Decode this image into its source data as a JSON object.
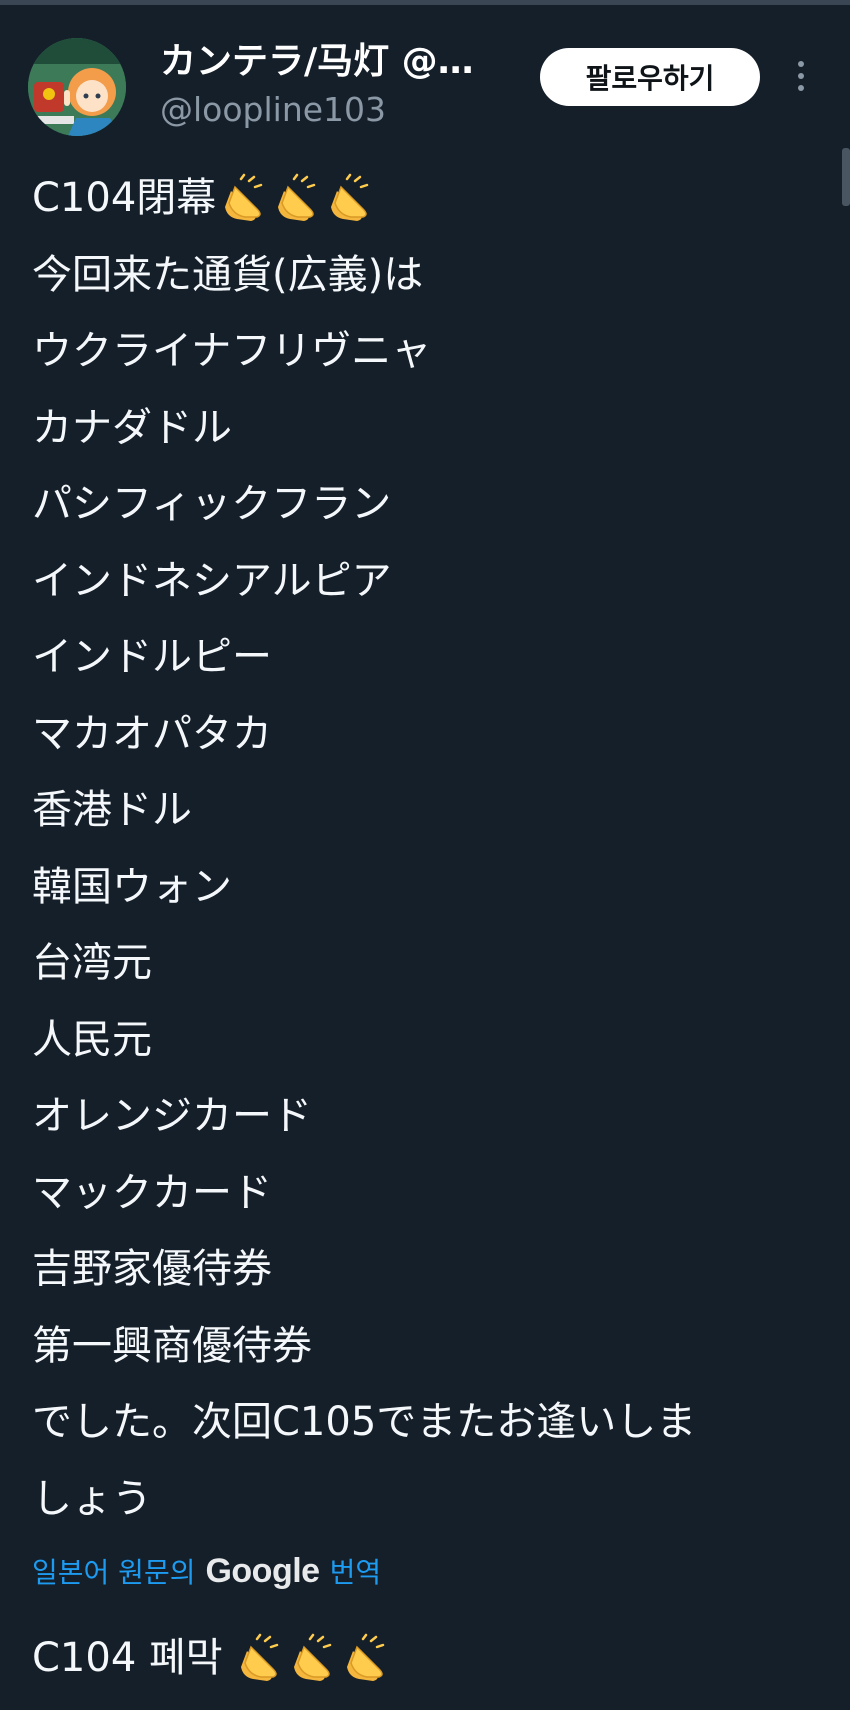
{
  "author": {
    "display_name": "カンテラ/马灯 @…",
    "handle": "@loopline103"
  },
  "actions": {
    "follow_label": "팔로우하기",
    "more_icon": "more-vertical-icon"
  },
  "tweet": {
    "lines": [
      "C104閉幕",
      "今回来た通貨(広義)は",
      "ウクライナフリヴニャ",
      "カナダドル",
      "パシフィックフラン",
      "インドネシアルピア",
      "インドルピー",
      "マカオパタカ",
      "香港ドル",
      "韓国ウォン",
      "台湾元",
      "人民元",
      "オレンジカード",
      "マックカード",
      "吉野家優待券",
      "第一興商優待券",
      "でした。次回C105でまたお逢いしま",
      "しょう"
    ],
    "emoji": "clapping-hands-icon"
  },
  "translate": {
    "prefix": "일본어 원문의",
    "brand": "Google",
    "suffix": "번역"
  },
  "translation": {
    "first_line": "C104 폐막"
  },
  "colors": {
    "background": "#151f2a",
    "text": "#f5f8fa",
    "muted": "#8b98a5",
    "link": "#1d9bf0"
  }
}
